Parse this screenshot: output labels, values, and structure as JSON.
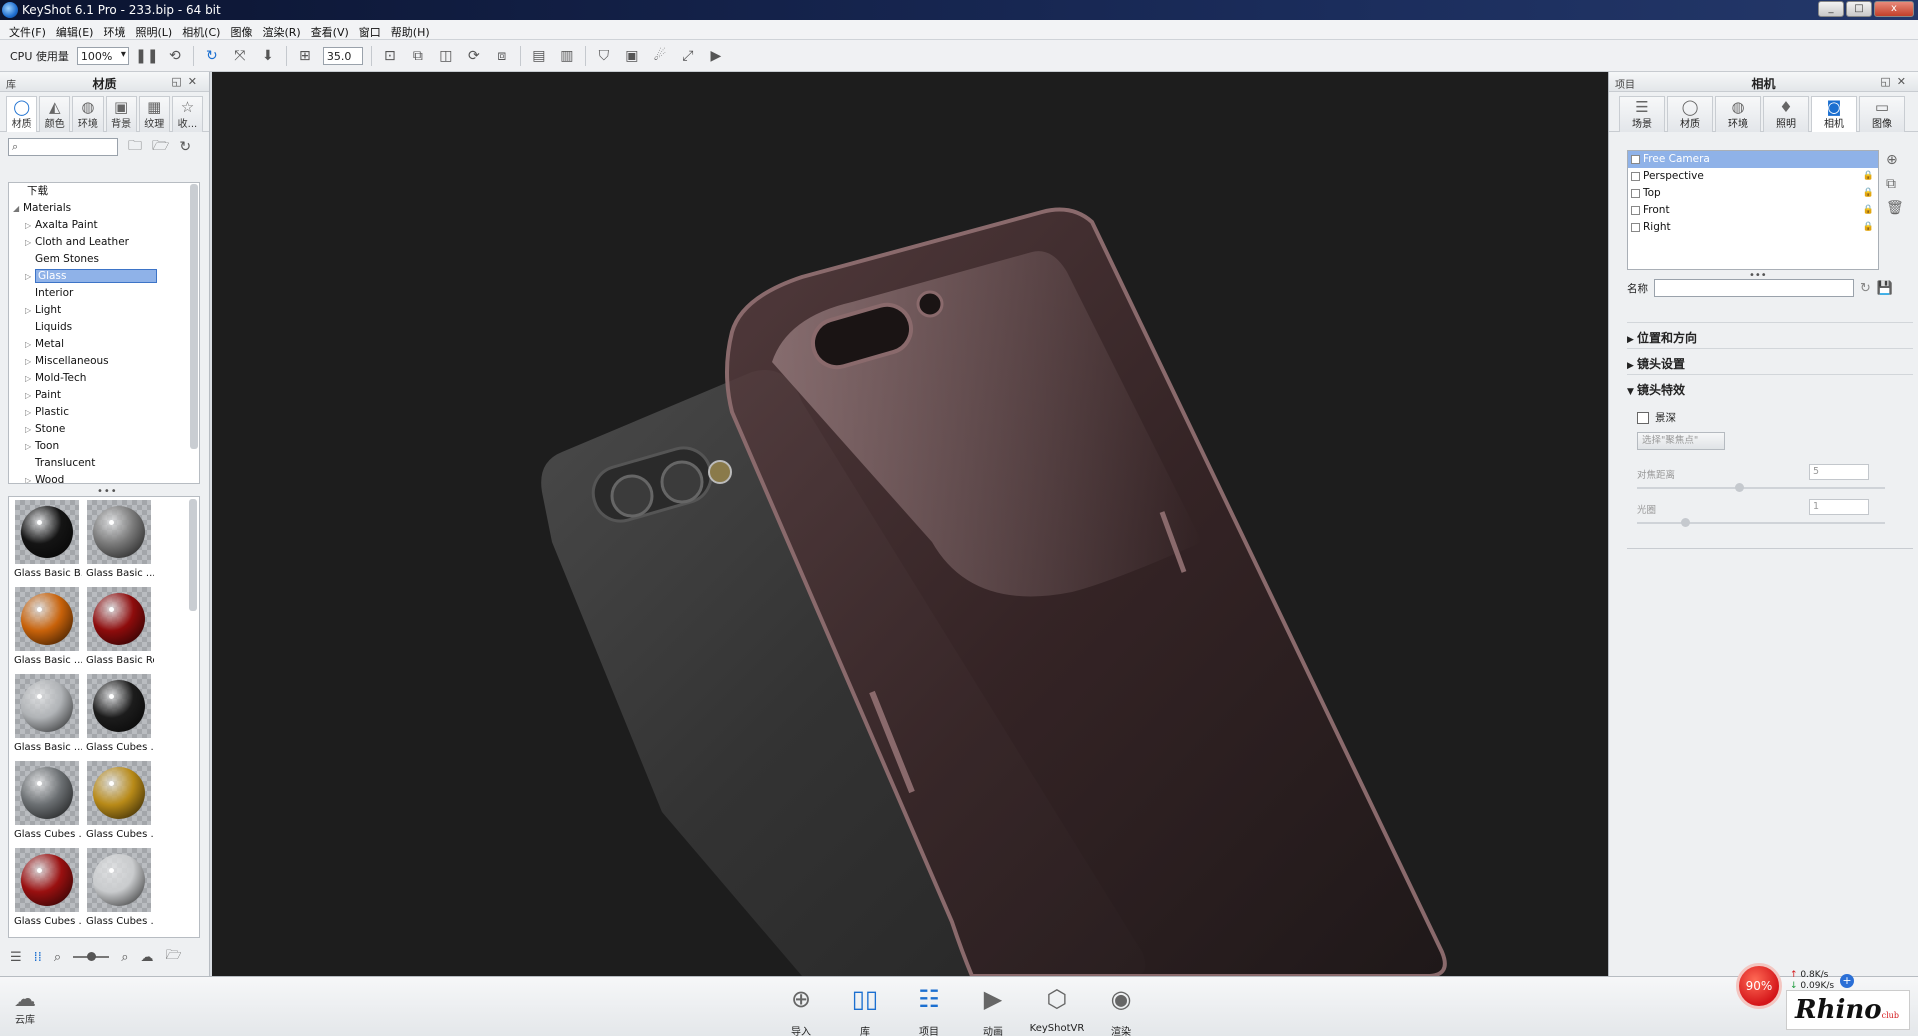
{
  "window": {
    "title": "KeyShot 6.1 Pro  - 233.bip  - 64 bit",
    "buttons": [
      "_",
      "□",
      "x"
    ]
  },
  "menu": [
    "文件(F)",
    "编辑(E)",
    "环境",
    "照明(L)",
    "相机(C)",
    "图像",
    "渲染(R)",
    "查看(V)",
    "窗口",
    "帮助(H)"
  ],
  "toolbar": {
    "cpu_label": "CPU 使用量",
    "cpu_value": "100%",
    "focal_value": "35.0"
  },
  "left_panel": {
    "header_left": "库",
    "title": "材质",
    "tabs": [
      {
        "label": "材质",
        "icon": "material-icon",
        "glyph": "◯"
      },
      {
        "label": "颜色",
        "icon": "color-icon",
        "glyph": "◭"
      },
      {
        "label": "环境",
        "icon": "environment-icon",
        "glyph": "◍"
      },
      {
        "label": "背景",
        "icon": "background-icon",
        "glyph": "▣"
      },
      {
        "label": "纹理",
        "icon": "texture-icon",
        "glyph": "▦"
      },
      {
        "label": "收...",
        "icon": "favorites-icon",
        "glyph": "☆"
      }
    ],
    "tree": {
      "top_item": "下载",
      "root": "Materials",
      "items": [
        {
          "label": "Axalta Paint",
          "arrow": true
        },
        {
          "label": "Cloth and Leather",
          "arrow": true
        },
        {
          "label": "Gem Stones",
          "arrow": false
        },
        {
          "label": "Glass",
          "arrow": true,
          "selected": true
        },
        {
          "label": "Interior",
          "arrow": false
        },
        {
          "label": "Light",
          "arrow": true
        },
        {
          "label": "Liquids",
          "arrow": false
        },
        {
          "label": "Metal",
          "arrow": true
        },
        {
          "label": "Miscellaneous",
          "arrow": true
        },
        {
          "label": "Mold-Tech",
          "arrow": true
        },
        {
          "label": "Paint",
          "arrow": true
        },
        {
          "label": "Plastic",
          "arrow": true
        },
        {
          "label": "Stone",
          "arrow": true
        },
        {
          "label": "Toon",
          "arrow": true
        },
        {
          "label": "Translucent",
          "arrow": false
        },
        {
          "label": "Wood",
          "arrow": true
        }
      ]
    },
    "thumbnails": [
      {
        "label": "Glass Basic B...",
        "color": "#141414"
      },
      {
        "label": "Glass Basic ...",
        "color": "#7a7a7a"
      },
      {
        "label": "Glass Basic ...",
        "color": "#c8620a"
      },
      {
        "label": "Glass Basic Red",
        "color": "#8e0c0c"
      },
      {
        "label": "Glass Basic ...",
        "color": "#b0b3b6"
      },
      {
        "label": "Glass Cubes ...",
        "color": "#1c1c1c"
      },
      {
        "label": "Glass Cubes ...",
        "color": "#6b6f72"
      },
      {
        "label": "Glass Cubes ...",
        "color": "#b88a18"
      },
      {
        "label": "Glass Cubes ...",
        "color": "#9a1010"
      },
      {
        "label": "Glass Cubes ...",
        "color": "#c9cbcd"
      }
    ]
  },
  "right_panel": {
    "header_left": "项目",
    "title": "相机",
    "tabs": [
      {
        "label": "场景",
        "icon": "scene-icon",
        "glyph": "☰"
      },
      {
        "label": "材质",
        "icon": "material-icon",
        "glyph": "◯"
      },
      {
        "label": "环境",
        "icon": "environment-icon",
        "glyph": "◍"
      },
      {
        "label": "照明",
        "icon": "lighting-icon",
        "glyph": "♦"
      },
      {
        "label": "相机",
        "icon": "camera-icon",
        "glyph": "◙"
      },
      {
        "label": "图像",
        "icon": "image-icon",
        "glyph": "▭"
      }
    ],
    "cameras": [
      {
        "label": "Free Camera",
        "selected": true,
        "locked": false
      },
      {
        "label": "Perspective",
        "selected": false,
        "locked": true
      },
      {
        "label": "Top",
        "selected": false,
        "locked": true
      },
      {
        "label": "Front",
        "selected": false,
        "locked": true
      },
      {
        "label": "Right",
        "selected": false,
        "locked": true
      }
    ],
    "name_label": "名称",
    "sections": [
      "位置和方向",
      "镜头设置",
      "镜头特效"
    ],
    "dof_label": "景深",
    "focus_button": "选择\"聚焦点\"",
    "focus_distance_label": "对焦距离",
    "focus_distance_value": "5",
    "fstop_label": "光圈",
    "fstop_value": "1"
  },
  "bottom": {
    "cloud_label": "云库",
    "buttons": [
      {
        "label": "导入",
        "icon": "import-icon",
        "glyph": "⊕"
      },
      {
        "label": "库",
        "icon": "library-icon",
        "glyph": "📖"
      },
      {
        "label": "项目",
        "icon": "project-icon",
        "glyph": "☷"
      },
      {
        "label": "动画",
        "icon": "animation-icon",
        "glyph": "▶"
      },
      {
        "label": "KeyShotVR",
        "icon": "keyshotvr-icon",
        "glyph": "⬡"
      },
      {
        "label": "渲染",
        "icon": "render-icon",
        "glyph": "◉"
      }
    ],
    "speed_percent": "90%",
    "net_up": "0.8K/s",
    "net_down": "0.09K/s",
    "logo_text": "Rhino",
    "logo_sub": "club"
  }
}
